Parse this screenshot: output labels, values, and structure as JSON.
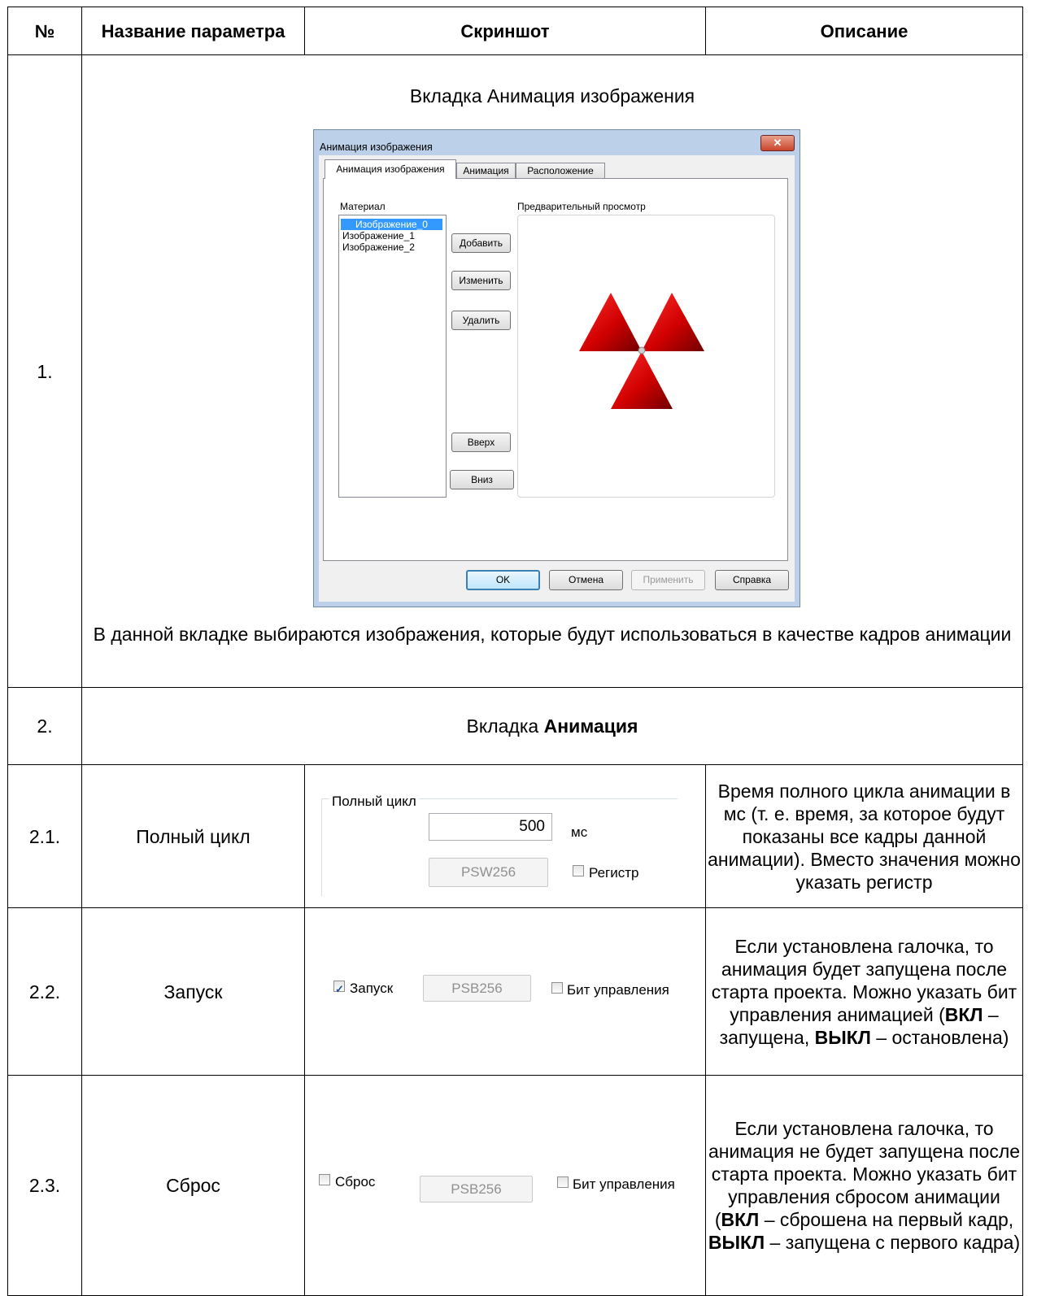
{
  "table": {
    "headers": {
      "num": "№",
      "name": "Название параметра",
      "screenshot": "Скриншот",
      "description": "Описание"
    },
    "row1": {
      "num": "1.",
      "section_title": "Вкладка Анимация изображения",
      "caption": "В данной вкладке выбираются изображения, которые будут использоваться в качестве кадров анимации"
    },
    "row2": {
      "num": "2.",
      "title_prefix": "Вкладка ",
      "title_bold": "Анимация"
    },
    "row21": {
      "num": "2.1.",
      "name": "Полный цикл",
      "description": "Время полного цикла анимации в мс (т. е. время, за которое будут показаны все кадры данной анимации). Вместо значения можно указать регистр"
    },
    "row22": {
      "num": "2.2.",
      "name": "Запуск",
      "description": {
        "p1": "Если установлена галочка, то анимация будет запущена после старта проекта. Можно указать бит управления анимацией (",
        "b1": "ВКЛ",
        "p2": " – запущена, ",
        "b2": "ВЫКЛ",
        "p3": " – остановлена)"
      }
    },
    "row23": {
      "num": "2.3.",
      "name": "Сброс",
      "description": {
        "p1": "Если установлена галочка, то анимация не будет запущена после старта проекта. Можно указать бит управления сбросом анимации (",
        "b1": "ВКЛ",
        "p2": " – сброшена на первый кадр, ",
        "b2": "ВЫКЛ",
        "p3": " – запущена с первого кадра)"
      }
    }
  },
  "dialog": {
    "title": "Анимация изображения",
    "tabs": [
      "Анимация изображения",
      "Анимация",
      "Расположение"
    ],
    "material_label": "Материал",
    "materials": [
      "Изображение_0",
      "Изображение_1",
      "Изображение_2"
    ],
    "preview_label": "Предварительный просмотр",
    "buttons": {
      "add": "Добавить",
      "edit": "Изменить",
      "delete": "Удалить",
      "up": "Вверх",
      "down": "Вниз"
    },
    "footer": {
      "ok": "OK",
      "cancel": "Отмена",
      "apply": "Применить",
      "help": "Справка"
    }
  },
  "cycle_panel": {
    "group_label": "Полный цикл",
    "value": "500",
    "unit": "мс",
    "register_field": "PSW256",
    "register_checkbox": "Регистр",
    "register_checked": false
  },
  "start_panel": {
    "checkbox": "Запуск",
    "checked": true,
    "field": "PSB256",
    "control_checkbox": "Бит управления",
    "control_checked": false
  },
  "reset_panel": {
    "checkbox": "Сброс",
    "checked": false,
    "field": "PSB256",
    "control_checkbox": "Бит управления",
    "control_checked": false
  },
  "colors": {
    "accent": "#3399ff",
    "triangle": "#e00000"
  }
}
